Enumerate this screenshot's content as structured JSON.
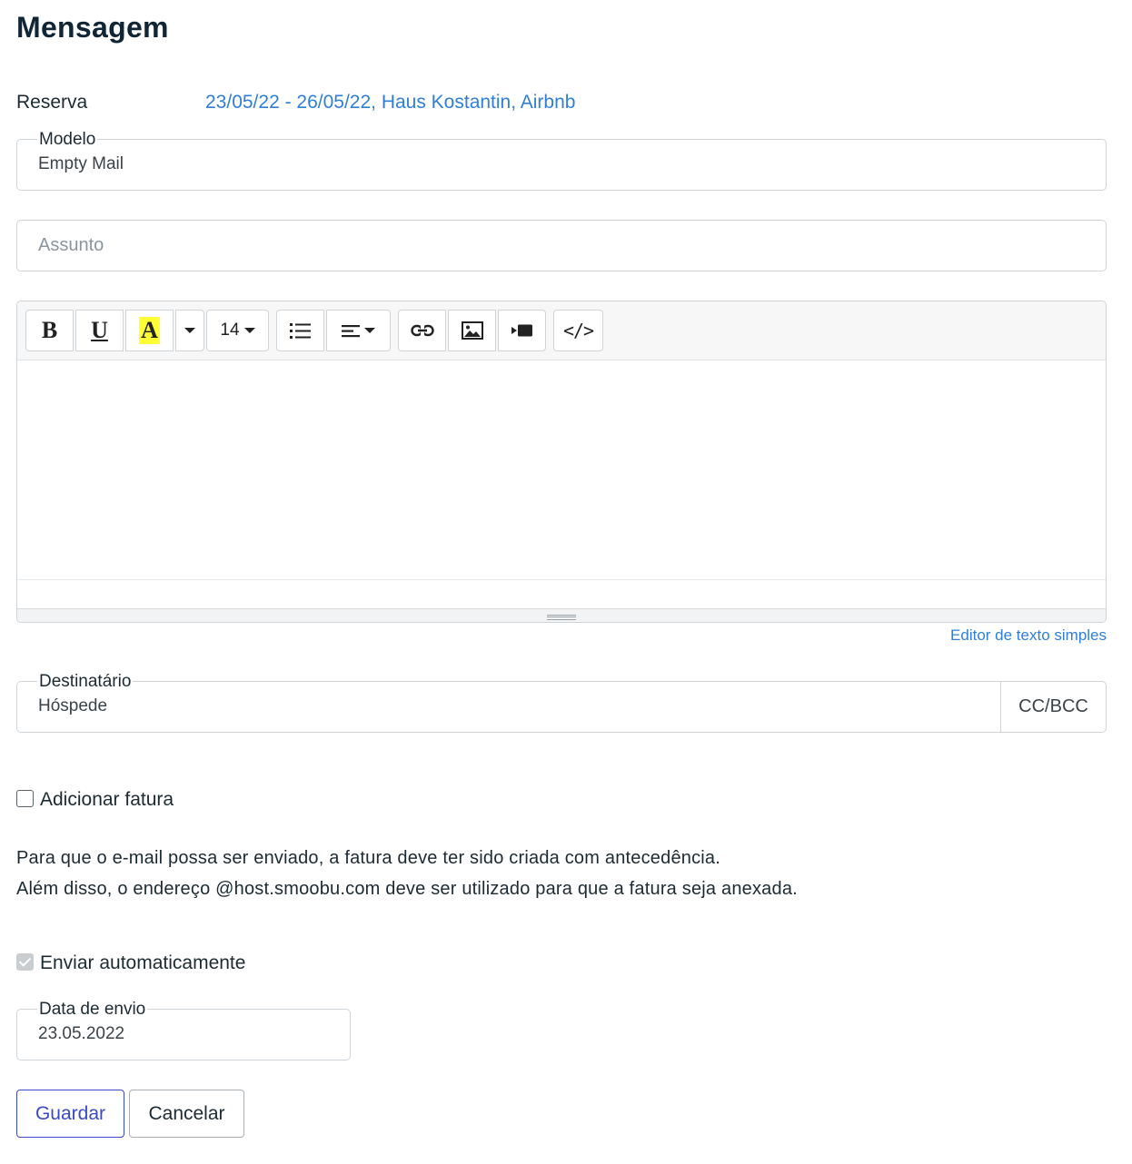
{
  "page": {
    "title": "Mensagem"
  },
  "reserva": {
    "label": "Reserva",
    "value": "23/05/22 - 26/05/22, Haus Kostantin, Airbnb"
  },
  "modelo": {
    "label": "Modelo",
    "value": "Empty Mail"
  },
  "assunto": {
    "placeholder": "Assunto"
  },
  "editor": {
    "font_size": "14",
    "toolbar": [
      "bold",
      "underline",
      "highlight-color",
      "color-dropdown",
      "font-size",
      "unordered-list",
      "align",
      "link",
      "image",
      "video",
      "code-view"
    ],
    "plain_text_link": "Editor de texto simples"
  },
  "destinatario": {
    "label": "Destinatário",
    "value": "Hóspede",
    "cc_label": "CC/BCC"
  },
  "fatura": {
    "label": "Adicionar fatura",
    "checked": false
  },
  "info": {
    "line1": "Para que o e-mail possa ser enviado, a fatura deve ter sido criada com antecedência.",
    "line2": "Além disso, o endereço @host.smoobu.com deve ser utilizado para que a fatura seja anexada."
  },
  "auto_send": {
    "label": "Enviar automaticamente",
    "checked": true,
    "disabled": true
  },
  "data_envio": {
    "label": "Data de envio",
    "value": "23.05.2022"
  },
  "actions": {
    "save": "Guardar",
    "cancel": "Cancelar"
  },
  "colors": {
    "accent": "#3949c9",
    "link": "#2f7fd8",
    "highlight": "#ffff33"
  }
}
